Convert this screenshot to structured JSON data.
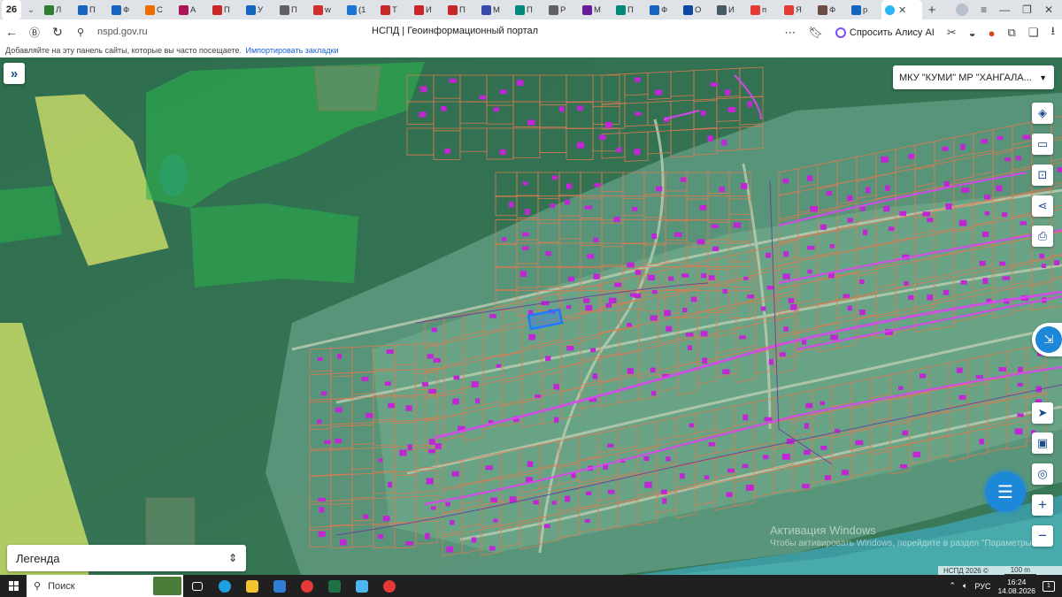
{
  "browser": {
    "tab_count": "26",
    "tabs": [
      {
        "label": "Л",
        "color": "#2e7d32"
      },
      {
        "label": "П",
        "color": "#1565c0"
      },
      {
        "label": "Ф",
        "color": "#1565c0"
      },
      {
        "label": "С",
        "color": "#ef6c00"
      },
      {
        "label": "А",
        "color": "#ad1457"
      },
      {
        "label": "П",
        "color": "#c62828"
      },
      {
        "label": "У",
        "color": "#1565c0"
      },
      {
        "label": "П",
        "color": "#616161"
      },
      {
        "label": "w",
        "color": "#d32f2f"
      },
      {
        "label": "(1",
        "color": "#1976d2"
      },
      {
        "label": "Т",
        "color": "#c62828"
      },
      {
        "label": "И",
        "color": "#c62828"
      },
      {
        "label": "П",
        "color": "#c62828"
      },
      {
        "label": "М",
        "color": "#3949ab"
      },
      {
        "label": "П",
        "color": "#00897b"
      },
      {
        "label": "Р",
        "color": "#616161"
      },
      {
        "label": "М",
        "color": "#6a1b9a"
      },
      {
        "label": "П",
        "color": "#00897b"
      },
      {
        "label": "Ф",
        "color": "#1565c0"
      },
      {
        "label": "О",
        "color": "#0d47a1"
      },
      {
        "label": "И",
        "color": "#455a64"
      },
      {
        "label": "п",
        "color": "#e53935"
      },
      {
        "label": "Я",
        "color": "#e53935"
      },
      {
        "label": "Ф",
        "color": "#6d4c41"
      },
      {
        "label": "р",
        "color": "#1565c0"
      }
    ],
    "active_tab_color": "#29b6f6",
    "url": "nspd.gov.ru",
    "page_title": "НСПД | Геоинформационный портал",
    "alice_label": "Спросить Алису AI",
    "bookmarks_text": "Добавляйте на эту панель сайты, которые вы часто посещаете.",
    "bookmarks_link": "Импортировать закладки"
  },
  "map": {
    "region_select": "МКУ \"КУМИ\" МР \"ХАНГАЛА...",
    "legend_label": "Легенда",
    "watermark_title": "Активация Windows",
    "watermark_text": "Чтобы активировать Windows, перейдите в раздел \"Параметры\".",
    "attribution": "НСПД 2026 ©",
    "scale_label": "100 m",
    "colors": {
      "parcel_outline": "#e07a4f",
      "building": "#c026d3",
      "selected_parcel": "#1e7bff",
      "forest_zone": "#2bb24c",
      "field_zone": "#d9e86a",
      "utility_line": "#d946ef"
    },
    "right_tools": [
      "layers-icon",
      "ruler-icon",
      "zoom-search-icon",
      "share-icon",
      "print-icon"
    ],
    "lower_tools": [
      "navigate-icon",
      "map-view-icon",
      "location-icon",
      "zoom-in-icon",
      "zoom-out-icon"
    ]
  },
  "taskbar": {
    "search_placeholder": "Поиск",
    "language": "РУС",
    "time": "16:24",
    "date": "14.08.2026",
    "notifications": "1",
    "apps": [
      {
        "name": "task-view-icon",
        "color": "#ffffff"
      },
      {
        "name": "edge-icon",
        "color": "#1fa0e0"
      },
      {
        "name": "explorer-icon",
        "color": "#f4c430"
      },
      {
        "name": "outlook-icon",
        "color": "#2f7fd7"
      },
      {
        "name": "yandex-browser-icon",
        "color": "#e53935"
      },
      {
        "name": "excel-icon",
        "color": "#1e7145"
      },
      {
        "name": "pen-app-icon",
        "color": "#4db6f0"
      },
      {
        "name": "app-ring-icon",
        "color": "#e53935"
      }
    ]
  }
}
